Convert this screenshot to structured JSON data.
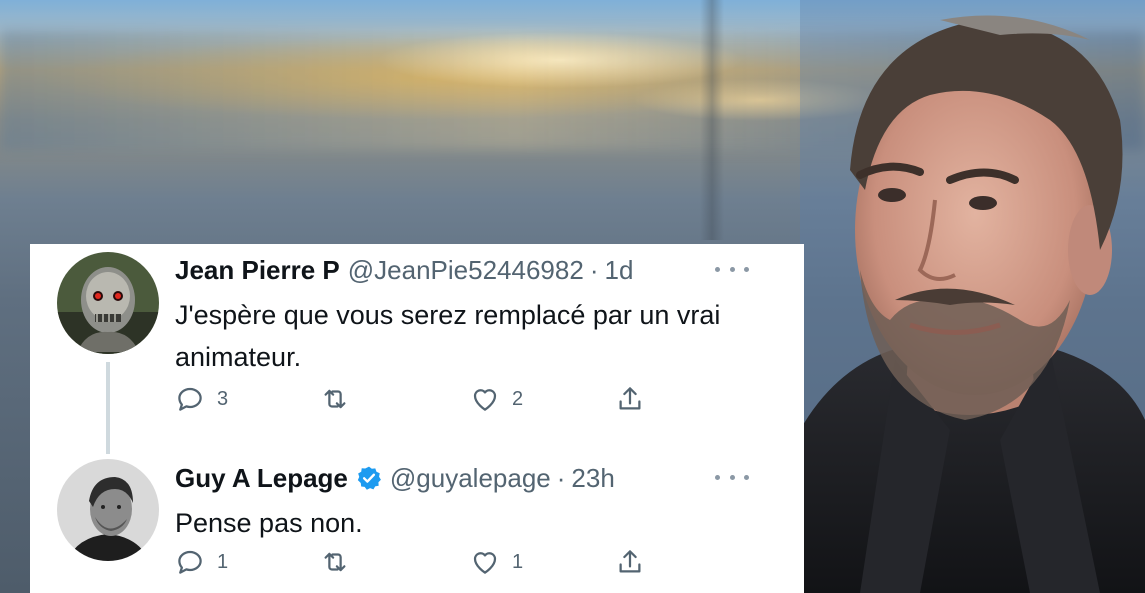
{
  "tweets": [
    {
      "name": "Jean Pierre P",
      "handle": "@JeanPie52446982",
      "separator": "·",
      "time": "1d",
      "text": "J'espère que vous serez remplacé par un vrai animateur.",
      "replies": "3",
      "likes": "2",
      "verified": false,
      "avatar": "terminator-robot-avatar"
    },
    {
      "name": "Guy A Lepage",
      "handle": "@guyalepage",
      "separator": "·",
      "time": "23h",
      "text": "Pense pas non.",
      "replies": "1",
      "likes": "1",
      "verified": true,
      "avatar": "guy-a-lepage-avatar"
    }
  ],
  "colors": {
    "primary_text": "#0f1419",
    "secondary_text": "#536471",
    "verified_blue": "#1d9bf0",
    "thread_line": "#cfd9de"
  },
  "icons": [
    "reply-icon",
    "retweet-icon",
    "like-icon",
    "share-icon",
    "more-icon",
    "verified-icon"
  ]
}
